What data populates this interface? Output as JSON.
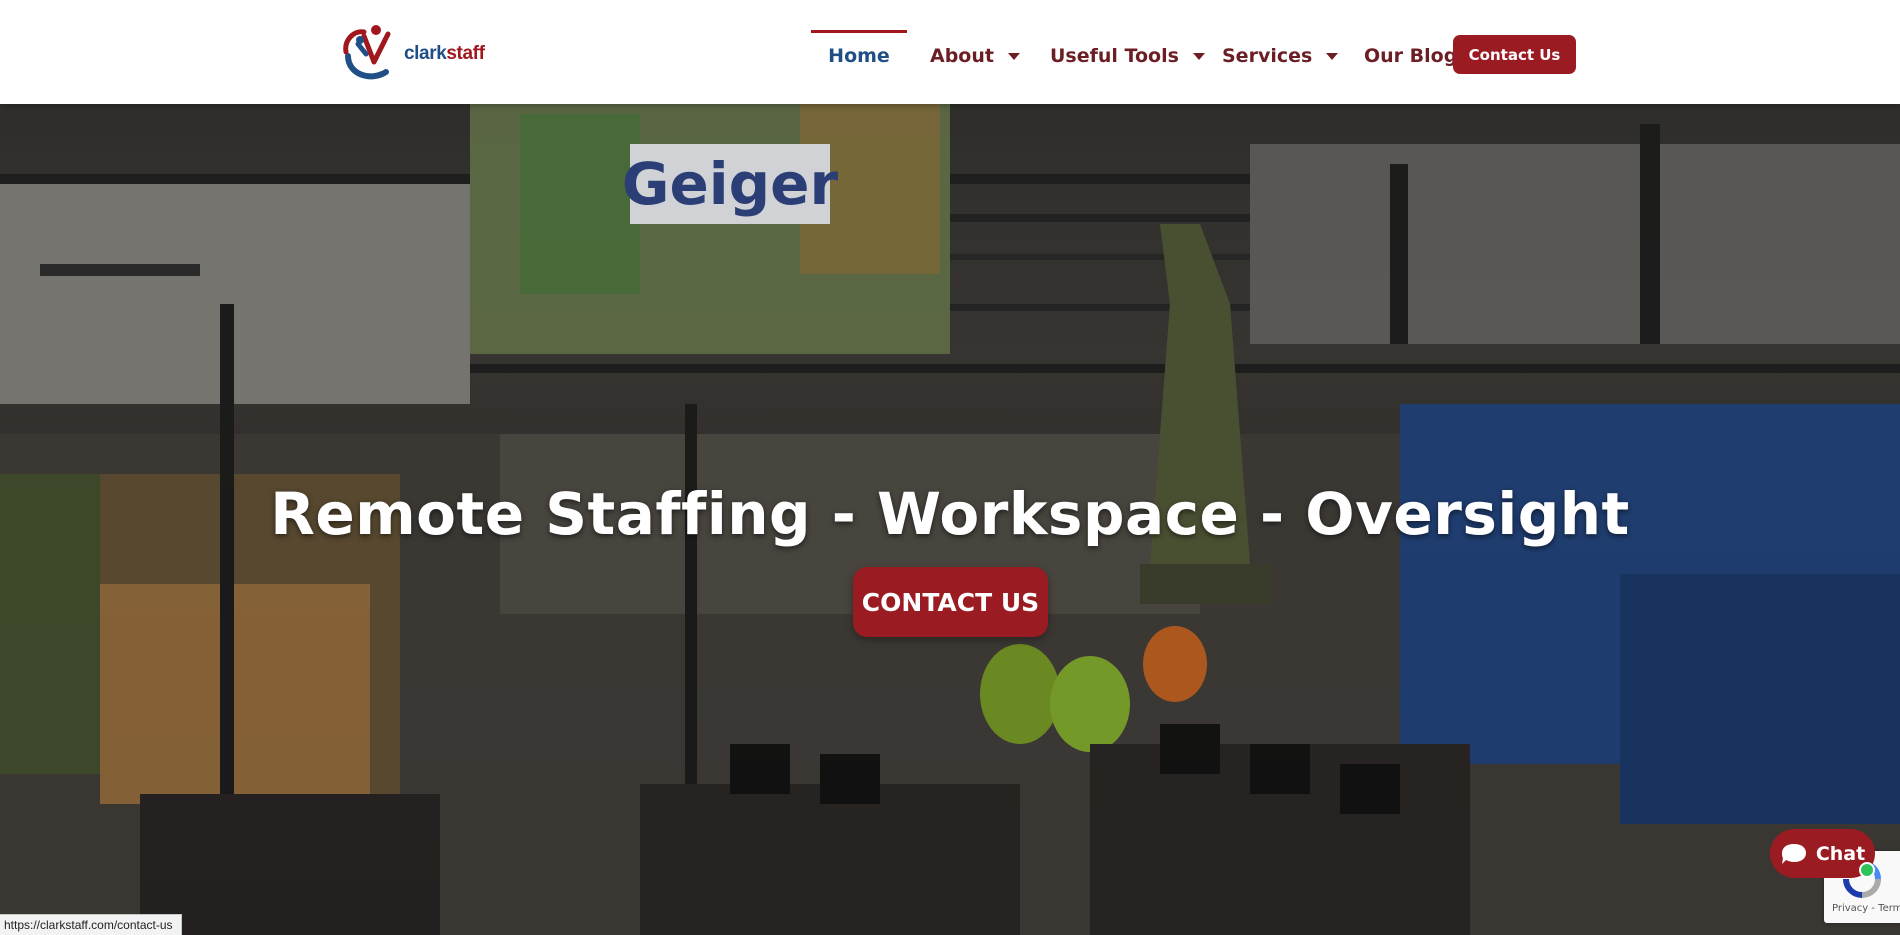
{
  "brand": {
    "name_part1": "clark",
    "name_part2": "staff",
    "primary_color": "#9b1b22",
    "secondary_color": "#1f4f86"
  },
  "nav": {
    "home": "Home",
    "about": "About",
    "tools": "Useful Tools",
    "services": "Services",
    "blog": "Our Blog",
    "contact_button": "Contact Us"
  },
  "hero": {
    "title": "Remote Staffing - Workspace - Oversight",
    "cta": "CONTACT US",
    "background": "office-floor-photo"
  },
  "chat": {
    "label": "Chat",
    "icon": "chat-bubble-icon",
    "status_color": "#2ec45a"
  },
  "recaptcha": {
    "links": "Privacy - Terms"
  },
  "status_bar": {
    "url": "https://clarkstaff.com/contact-us"
  }
}
